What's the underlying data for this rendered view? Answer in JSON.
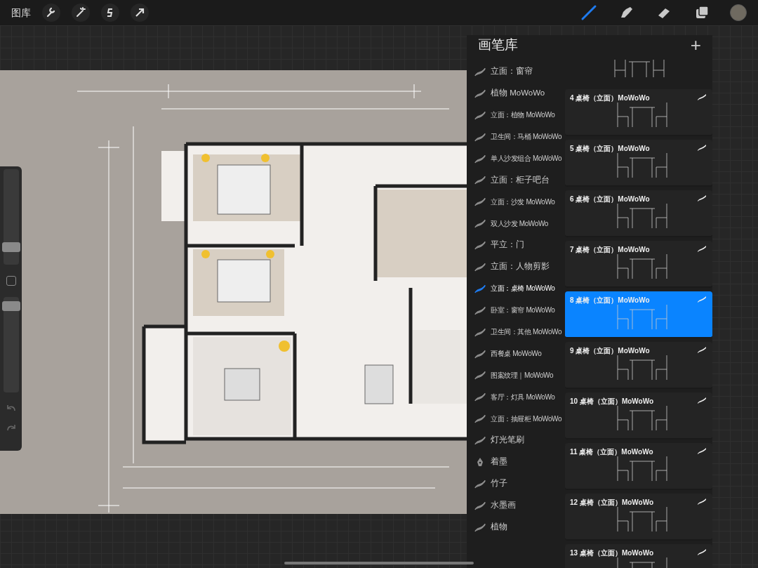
{
  "toolbar": {
    "gallery": "图库",
    "actions": [
      {
        "kind": "wrench"
      },
      {
        "kind": "wand"
      },
      {
        "kind": "select"
      },
      {
        "kind": "move"
      }
    ],
    "tools": [
      {
        "kind": "brush",
        "selected": true
      },
      {
        "kind": "smudge",
        "selected": false
      },
      {
        "kind": "eraser",
        "selected": false
      },
      {
        "kind": "layers",
        "selected": false
      }
    ],
    "color": "#6f6a60"
  },
  "sidebar": {
    "sliders": [
      {
        "level": 0.15
      },
      {
        "level": 0.95
      }
    ]
  },
  "brush_library": {
    "title": "画笔库",
    "add": "+",
    "categories": [
      {
        "name": "立面：窗帘",
        "kind": "stroke",
        "selected": false
      },
      {
        "name": "植物 MoWoWo",
        "kind": "stroke",
        "selected": false
      },
      {
        "name": "立面：植物 MoWoWo",
        "kind": "stroke",
        "selected": false
      },
      {
        "name": "卫生间：马桶 MoWoWo",
        "kind": "stroke",
        "selected": false
      },
      {
        "name": "单人沙发组合 MoWoWo",
        "kind": "stroke",
        "selected": false
      },
      {
        "name": "立面：柜子吧台",
        "kind": "stroke",
        "selected": false
      },
      {
        "name": "立面：沙发 MoWoWo",
        "kind": "stroke",
        "selected": false
      },
      {
        "name": "双人沙发 MoWoWo",
        "kind": "stroke",
        "selected": false
      },
      {
        "name": "平立：门",
        "kind": "stroke",
        "selected": false
      },
      {
        "name": "立面：人物剪影",
        "kind": "stroke",
        "selected": false
      },
      {
        "name": "立面：桌椅 MoWoWo",
        "kind": "stroke",
        "selected": true
      },
      {
        "name": "卧室：窗帘 MoWoWo",
        "kind": "stroke",
        "selected": false
      },
      {
        "name": "卫生间：其他 MoWoWo",
        "kind": "stroke",
        "selected": false
      },
      {
        "name": "西餐桌 MoWoWo",
        "kind": "stroke",
        "selected": false
      },
      {
        "name": "图案纹理｜MoWoWo",
        "kind": "stroke",
        "selected": false
      },
      {
        "name": "客厅：灯具 MoWoWo",
        "kind": "stroke",
        "selected": false
      },
      {
        "name": "立面：抽屉柜 MoWoWo",
        "kind": "stroke",
        "selected": false
      },
      {
        "name": "灯光笔刷",
        "kind": "stroke",
        "selected": false
      },
      {
        "name": "着墨",
        "kind": "nib",
        "selected": false
      },
      {
        "name": "竹子",
        "kind": "stroke",
        "selected": false
      },
      {
        "name": "水墨画",
        "kind": "stroke",
        "selected": false
      },
      {
        "name": "植物",
        "kind": "stroke",
        "selected": false
      }
    ],
    "brushes": [
      {
        "name": "4 桌椅（立面）MoWoWo",
        "selected": false
      },
      {
        "name": "5 桌椅（立面）MoWoWo",
        "selected": false
      },
      {
        "name": "6 桌椅（立面）MoWoWo",
        "selected": false
      },
      {
        "name": "7 桌椅（立面）MoWoWo",
        "selected": false
      },
      {
        "name": "8 桌椅（立面）MoWoWo",
        "selected": true
      },
      {
        "name": "9 桌椅（立面）MoWoWo",
        "selected": false
      },
      {
        "name": "10 桌椅（立面）MoWoWo",
        "selected": false
      },
      {
        "name": "11 桌椅（立面）MoWoWo",
        "selected": false
      },
      {
        "name": "12 桌椅（立面）MoWoWo",
        "selected": false
      },
      {
        "name": "13 桌椅（立面）MoWoWo",
        "selected": false
      }
    ]
  }
}
